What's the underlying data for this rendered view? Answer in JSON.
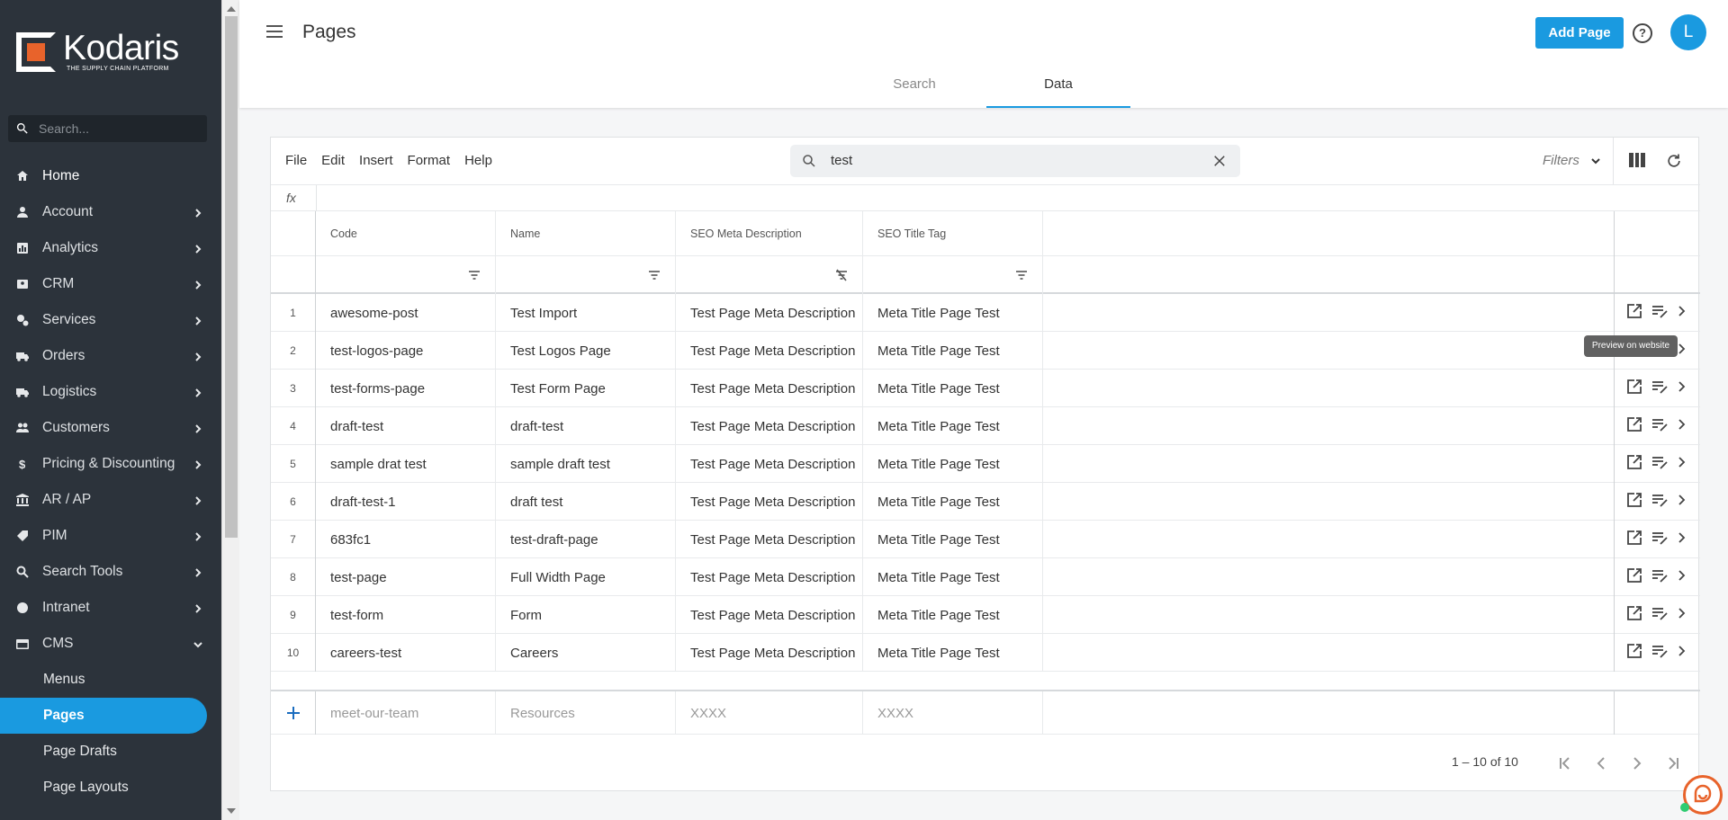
{
  "brand": {
    "name": "Kodaris",
    "tagline": "THE SUPPLY CHAIN PLATFORM",
    "accent": "#1a9ae0",
    "logo_color": "#e8632b"
  },
  "sidebar": {
    "search_placeholder": "Search...",
    "items": [
      {
        "label": "Home",
        "icon": "home-icon",
        "expandable": false
      },
      {
        "label": "Account",
        "icon": "person-icon",
        "expandable": true
      },
      {
        "label": "Analytics",
        "icon": "analytics-icon",
        "expandable": true
      },
      {
        "label": "CRM",
        "icon": "contact-card-icon",
        "expandable": true
      },
      {
        "label": "Services",
        "icon": "gears-icon",
        "expandable": true
      },
      {
        "label": "Orders",
        "icon": "truck-icon",
        "expandable": true
      },
      {
        "label": "Logistics",
        "icon": "delivery-truck-icon",
        "expandable": true
      },
      {
        "label": "Customers",
        "icon": "people-icon",
        "expandable": true
      },
      {
        "label": "Pricing & Discounting",
        "icon": "dollar-icon",
        "expandable": true
      },
      {
        "label": "AR / AP",
        "icon": "bank-icon",
        "expandable": true
      },
      {
        "label": "PIM",
        "icon": "tag-icon",
        "expandable": true
      },
      {
        "label": "Search Tools",
        "icon": "search-icon",
        "expandable": true
      },
      {
        "label": "Intranet",
        "icon": "globe-icon",
        "expandable": true
      },
      {
        "label": "CMS",
        "icon": "web-icon",
        "expandable": true,
        "expanded": true
      }
    ],
    "cms_children": [
      "Menus",
      "Pages",
      "Page Drafts",
      "Page Layouts"
    ],
    "active_child": "Pages"
  },
  "header": {
    "title": "Pages",
    "add_button": "Add Page",
    "help": "?",
    "avatar": "L",
    "tabs": [
      {
        "label": "Search",
        "active": false
      },
      {
        "label": "Data",
        "active": true
      }
    ]
  },
  "toolbar": {
    "menu": [
      "File",
      "Edit",
      "Insert",
      "Format",
      "Help"
    ],
    "search_value": "test",
    "filters_label": "Filters",
    "fx_label": "fx"
  },
  "grid": {
    "columns": [
      "Code",
      "Name",
      "SEO Meta Description",
      "SEO Title Tag"
    ],
    "rows": [
      [
        "1",
        "awesome-post",
        "Test Import",
        "Test Page Meta Description",
        "Meta Title Page Test"
      ],
      [
        "2",
        "test-logos-page",
        "Test Logos Page",
        "Test Page Meta Description",
        "Meta Title Page Test"
      ],
      [
        "3",
        "test-forms-page",
        "Test Form Page",
        "Test Page Meta Description",
        "Meta Title Page Test"
      ],
      [
        "4",
        "draft-test",
        "draft-test",
        "Test Page Meta Description",
        "Meta Title Page Test"
      ],
      [
        "5",
        "sample drat test",
        "sample draft test",
        "Test Page Meta Description",
        "Meta Title Page Test"
      ],
      [
        "6",
        "draft-test-1",
        "draft test",
        "Test Page Meta Description",
        "Meta Title Page Test"
      ],
      [
        "7",
        "683fc1",
        "test-draft-page",
        "Test Page Meta Description",
        "Meta Title Page Test"
      ],
      [
        "8",
        "test-page",
        "Full Width Page",
        "Test Page Meta Description",
        "Meta Title Page Test"
      ],
      [
        "9",
        "test-form",
        "Form",
        "Test Page Meta Description",
        "Meta Title Page Test"
      ],
      [
        "10",
        "careers-test",
        "Careers",
        "Test Page Meta Description",
        "Meta Title Page Test"
      ]
    ],
    "new_row": {
      "code": "meet-our-team",
      "name": "Resources",
      "seo_meta": "XXXX",
      "seo_title": "XXXX"
    },
    "pager_info": "1 – 10 of 10",
    "tooltip": "Preview on website"
  }
}
